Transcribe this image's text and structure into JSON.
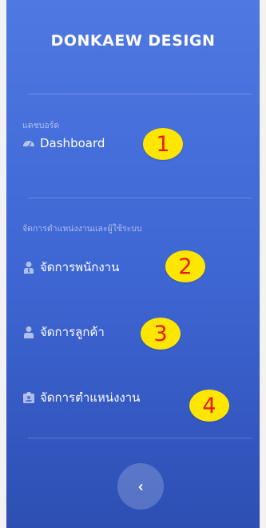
{
  "brand": {
    "title": "DONKAEW DESIGN"
  },
  "sections": [
    {
      "heading": "แดชบอร์ด"
    },
    {
      "heading": "จัดการตำแหน่งงานและผู้ใช้ระบบ"
    }
  ],
  "nav": {
    "dashboard": {
      "label": "Dashboard",
      "icon": "tachometer-icon"
    },
    "employees": {
      "label": "จัดการพนักงาน",
      "icon": "user-tie-icon"
    },
    "customers": {
      "label": "จัดการลูกค้า",
      "icon": "user-icon"
    },
    "positions": {
      "label": "จัดการตำแหน่งงาน",
      "icon": "id-badge-icon"
    }
  },
  "badges": [
    "1",
    "2",
    "3",
    "4"
  ],
  "toggle": {
    "icon": "chevron-left-icon"
  },
  "colors": {
    "sidebar_top": "#4f78e2",
    "sidebar_bottom": "#2d4fb4",
    "badge_fill": "#ffe600",
    "badge_text": "#e11c1c"
  }
}
